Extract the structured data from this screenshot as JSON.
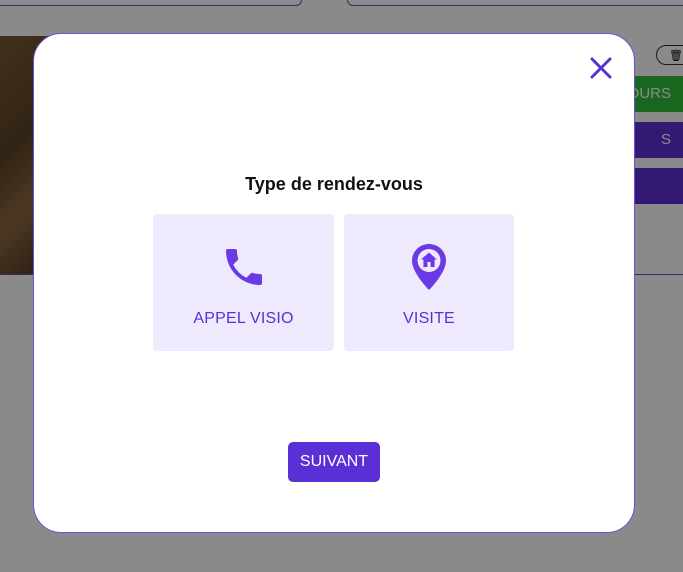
{
  "background": {
    "buttons": [
      "OURS",
      "S",
      ""
    ]
  },
  "modal": {
    "title": "Type de rendez-vous",
    "options": [
      {
        "label": "APPEL VISIO",
        "icon": "phone-icon"
      },
      {
        "label": "VISITE",
        "icon": "location-home-pin-icon"
      }
    ],
    "next_label": "SUIVANT",
    "close_icon": "close-icon"
  },
  "colors": {
    "accent": "#5b2fd6",
    "option_bg": "#efe9fd",
    "green": "#2fbf3a"
  }
}
